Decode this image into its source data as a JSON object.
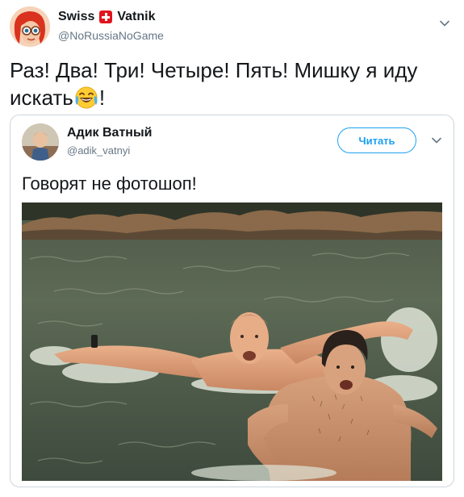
{
  "tweet": {
    "author": {
      "display_name": "Swiss",
      "display_name_suffix": "Vatnik",
      "handle": "@NoRussiaNoGame"
    },
    "text": "Раз! Два! Три! Четыре! Пять! Мишку я иду искать",
    "text_end": "!",
    "emoji": "face-with-tears-of-joy"
  },
  "quoted_tweet": {
    "author": {
      "display_name": "Адик Ватный",
      "handle": "@adik_vatnyi"
    },
    "follow_label": "Читать",
    "text": "Говорят не фотошоп!",
    "media": "photo-two-men-swimming-in-river"
  },
  "colors": {
    "brand": "#1da1f2",
    "text": "#14171a",
    "secondary": "#657786",
    "border": "#ccd6dd",
    "flag": "#e1141e"
  }
}
